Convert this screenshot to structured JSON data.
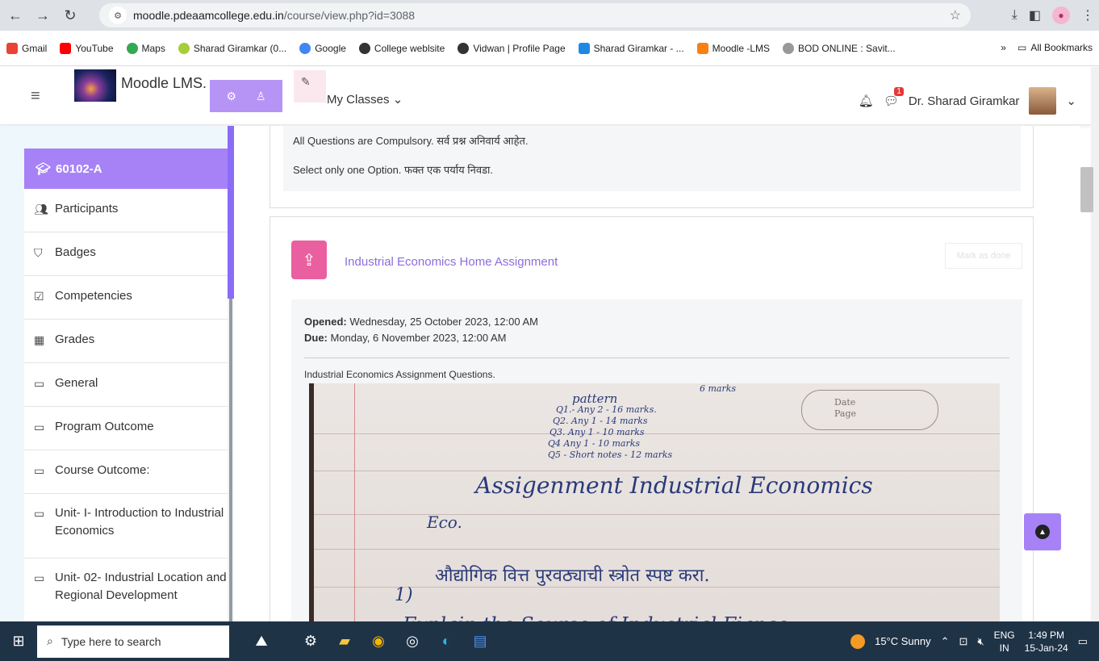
{
  "browser": {
    "url_domain": "moodle.pdeaamcollege.edu.in",
    "url_path": "/course/view.php?id=3088",
    "bookmarks": [
      "Gmail",
      "YouTube",
      "Maps",
      "Sharad Giramkar (0...",
      "Google",
      "College weblsite",
      "Vidwan | Profile Page",
      "Sharad Giramkar - ...",
      "Moodle -LMS",
      "BOD ONLINE : Savit..."
    ],
    "more_label": "»",
    "all_bookmarks": "All Bookmarks"
  },
  "navbar": {
    "site_name": "Moodle LMS.",
    "my_classes": "My Classes",
    "message_count": "1",
    "user_name": "Dr. Sharad Giramkar"
  },
  "sidebar": {
    "active": "60102-A",
    "items": [
      {
        "label": "Participants",
        "icon": "users-icon"
      },
      {
        "label": "Badges",
        "icon": "shield-icon"
      },
      {
        "label": "Competencies",
        "icon": "checkbox-icon"
      },
      {
        "label": "Grades",
        "icon": "table-icon"
      },
      {
        "label": "General",
        "icon": "folder-icon"
      },
      {
        "label": "Program Outcome",
        "icon": "folder-icon"
      },
      {
        "label": "Course Outcome:",
        "icon": "folder-icon"
      },
      {
        "label": "Unit- I- Introduction to Industrial Economics",
        "icon": "folder-icon"
      },
      {
        "label": "Unit- 02- Industrial Location and Regional Development",
        "icon": "folder-icon"
      }
    ]
  },
  "main": {
    "instructions": [
      "All Questions are Compulsory. सर्व प्रश्न अनिवार्य आहेत.",
      "Select only one Option. फक्त एक पर्याय निवडा."
    ],
    "assignment": {
      "title": "Industrial Economics Home Assignment",
      "mark_done": "Mark as done",
      "opened_label": "Opened:",
      "opened_value": " Wednesday, 25 October 2023, 12:00 AM",
      "due_label": "Due:",
      "due_value": " Monday, 6 November 2023, 12:00 AM",
      "description": "Industrial Economics Assignment Questions.",
      "handwriting": {
        "top_note": "6 marks",
        "pattern": "pattern",
        "q1": "Q1.- Any 2 - 16 marks.",
        "q2": "Q2. Any 1 - 14 marks",
        "q3": "Q3. Any 1 - 10 marks",
        "q4": "Q4 Any 1 - 10 marks",
        "q5": "Q5 - Short notes - 12 marks",
        "heading": "Assigenment  Industrial Economics",
        "eco": "Eco.",
        "marathi_q": "औद्योगिक वित्त पुरवठ्याची स्त्रोत स्पष्ट करा.",
        "num": "1)",
        "english_q": "Explain the Source of Industrial Fiance",
        "date_label": "Date",
        "page_label": "Page"
      }
    }
  },
  "taskbar": {
    "search_placeholder": "Type here to search",
    "weather": "15°C  Sunny",
    "lang_top": "ENG",
    "lang_bottom": "IN",
    "time": "1:49 PM",
    "date": "15-Jan-24"
  }
}
